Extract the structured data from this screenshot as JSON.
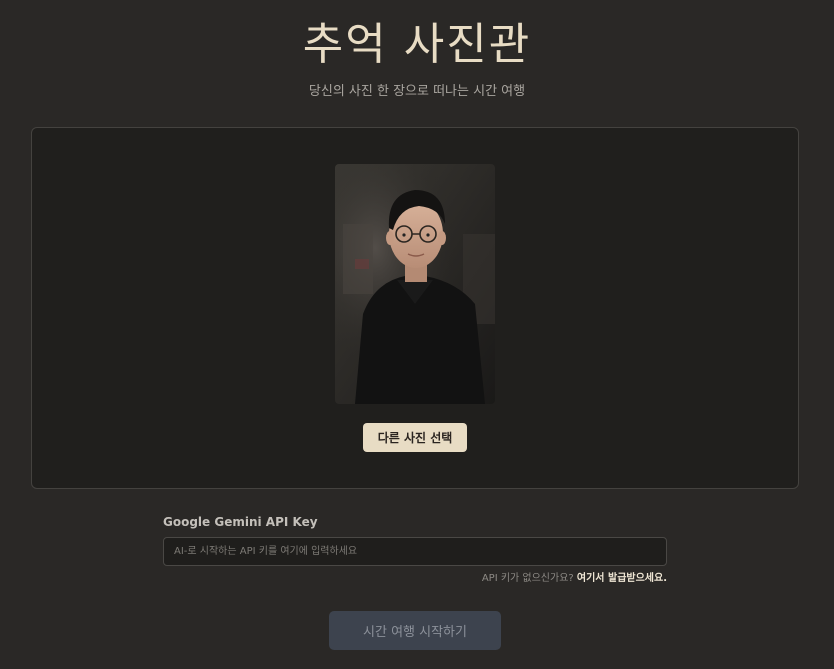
{
  "header": {
    "title": "추억 사진관",
    "subtitle": "당신의 사진 한 장으로 떠나는 시간 여행"
  },
  "upload": {
    "photo_icon": "uploaded-portrait-photo",
    "change_button_label": "다른 사진 선택"
  },
  "api_key": {
    "label": "Google Gemini API Key",
    "value": "",
    "placeholder": "AI-로 시작하는 API 키를 여기에 입력하세요",
    "help_text": "API 키가 없으신가요?",
    "help_link": "여기서 발급받으세요."
  },
  "actions": {
    "start_button_label": "시간 여행 시작하기"
  },
  "colors": {
    "background": "#2a2826",
    "panel": "#201f1d",
    "accent": "#e8dcc4",
    "disabled_button": "#3d434e"
  }
}
